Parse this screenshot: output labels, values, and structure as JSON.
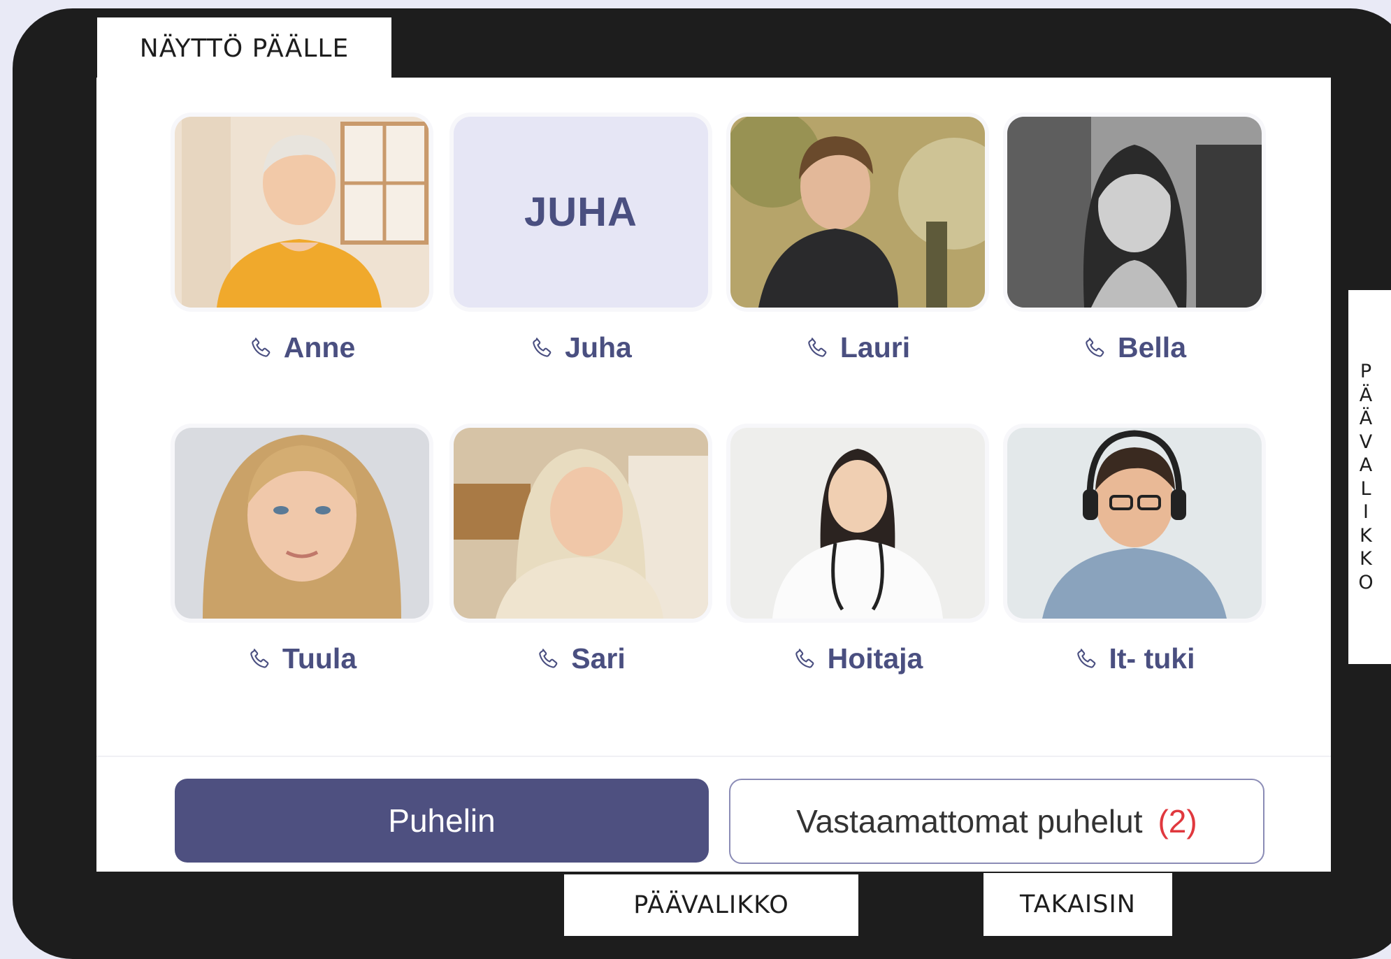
{
  "device": {
    "screen_on_label": "NÄYTTÖ PÄÄLLE",
    "side_menu_label": "PÄÄVALIKKO",
    "bottom_menu_label": "PÄÄVALIKKO",
    "back_label": "TAKAISIN"
  },
  "contacts": [
    {
      "name": "Anne",
      "photo": "portrait-older-woman-yellow-top"
    },
    {
      "name": "Juha",
      "initials": "JUHA"
    },
    {
      "name": "Lauri",
      "photo": "portrait-young-man-dark-coat"
    },
    {
      "name": "Bella",
      "photo": "portrait-woman-black-and-white"
    },
    {
      "name": "Tuula",
      "photo": "portrait-young-blonde-woman"
    },
    {
      "name": "Sari",
      "photo": "portrait-elderly-woman-cream-sweater"
    },
    {
      "name": "Hoitaja",
      "photo": "portrait-nurse-stethoscope"
    },
    {
      "name": "It- tuki",
      "photo": "portrait-man-headset"
    }
  ],
  "actions": {
    "phone_label": "Puhelin",
    "missed_calls_label": "Vastaamattomat puhelut",
    "missed_calls_count": "(2)"
  },
  "icons": {
    "call": "phone-icon"
  },
  "colors": {
    "accent": "#4e5080",
    "name_text": "#4a4f80",
    "missed_count": "#e0383e",
    "device_frame": "#1d1d1d"
  }
}
